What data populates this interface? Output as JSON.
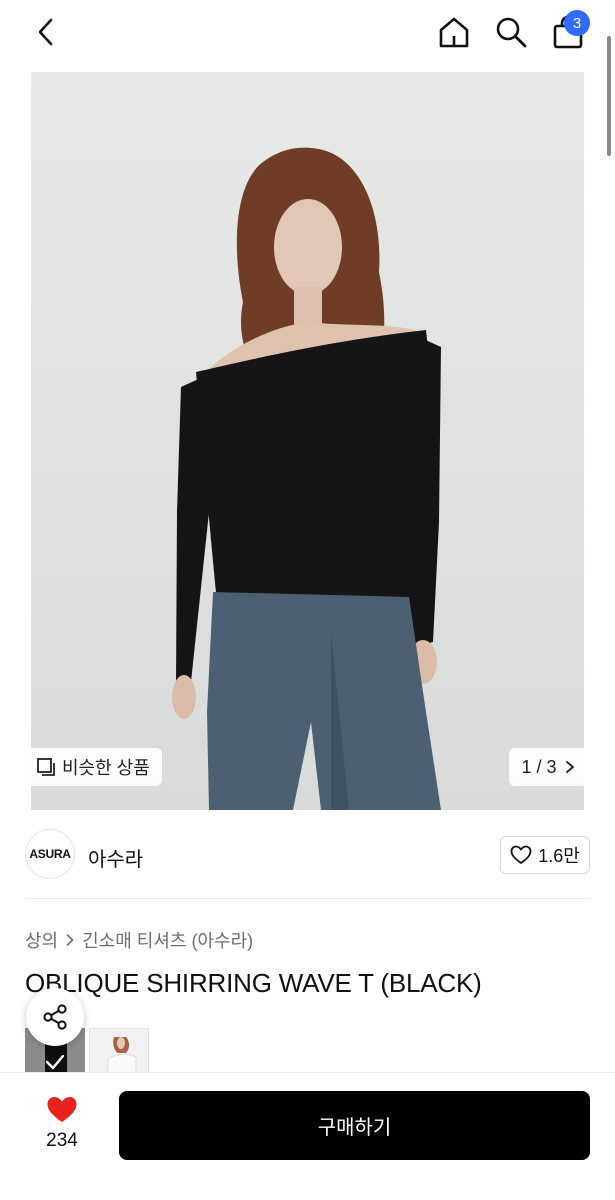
{
  "cart": {
    "badge_count": "3"
  },
  "hero": {
    "similar_label": "비슷한 상품",
    "pager": "1 / 3"
  },
  "brand": {
    "logo_text": "ASURA",
    "name": "아수라",
    "like_count": "1.6만"
  },
  "breadcrumb": {
    "category": "상의",
    "subcategory": "긴소매 티셔츠 (아수라)"
  },
  "product": {
    "title": "OBLIQUE SHIRRING WAVE T (BLACK)"
  },
  "bottom": {
    "like_count": "234",
    "buy_label": "구매하기"
  },
  "colors": {
    "accent_blue": "#2f6bff",
    "heart_red": "#e8231d",
    "buy_button": "#000000"
  },
  "icons": [
    "chevron-left-icon",
    "home-icon",
    "search-icon",
    "shopping-bag-icon",
    "similar-items-icon",
    "chevron-right-icon",
    "heart-outline-icon",
    "share-icon",
    "heart-filled-icon",
    "check-icon"
  ]
}
